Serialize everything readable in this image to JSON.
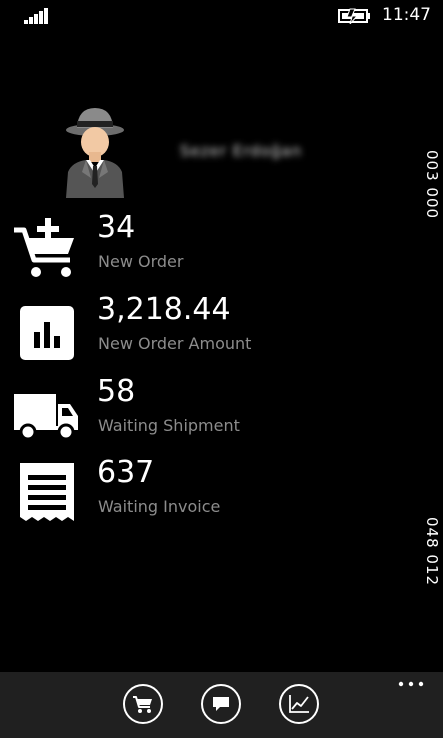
{
  "status": {
    "time": "11:47",
    "signal_icon": "signal-strength-icon",
    "battery_icon": "battery-charging-icon"
  },
  "profile": {
    "user_name": "Sezer Erdoğan",
    "avatar_icon": "detective-avatar-icon"
  },
  "side_labels": {
    "top": "003 000",
    "bottom": "048 012"
  },
  "metrics": [
    {
      "value": "34",
      "label": "New Order",
      "icon": "cart-add-icon"
    },
    {
      "value": "3,218.44",
      "label": "New Order Amount",
      "icon": "bar-chart-icon"
    },
    {
      "value": "58",
      "label": "Waiting Shipment",
      "icon": "truck-icon"
    },
    {
      "value": "637",
      "label": "Waiting Invoice",
      "icon": "invoice-icon"
    }
  ],
  "app_bar": {
    "buttons": [
      {
        "icon": "cart-icon"
      },
      {
        "icon": "message-icon"
      },
      {
        "icon": "chart-line-icon"
      }
    ],
    "more_icon": "more-ellipsis-icon"
  },
  "colors": {
    "background": "#000000",
    "app_bar": "#202020",
    "label": "#8c8c8c",
    "text": "#ffffff"
  }
}
